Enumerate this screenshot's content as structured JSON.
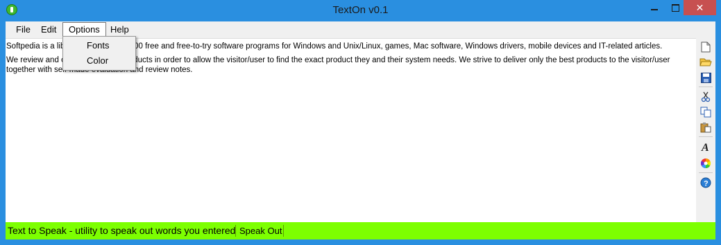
{
  "window": {
    "title": "TextOn v0.1",
    "controls": {
      "minimize": "minimize",
      "maximize": "maximize",
      "close": "✕"
    }
  },
  "menu": {
    "file": "File",
    "edit": "Edit",
    "options": "Options",
    "help": "Help"
  },
  "options_menu": {
    "items": [
      "Fonts",
      "Color"
    ]
  },
  "editor": {
    "paragraph1": "Softpedia is a library of over 1,300,000 free and free-to-try software programs for Windows and Unix/Linux, games, Mac software, Windows drivers, mobile devices and IT-related articles.",
    "paragraph2": "We review and categorize these products in order to allow the visitor/user to find the exact product they and their system needs. We strive to deliver only the best products to the visitor/user together with self-made evaluation and review notes."
  },
  "toolbar": {
    "icons": [
      "new-file-icon",
      "open-folder-icon",
      "save-icon",
      "cut-icon",
      "copy-icon",
      "paste-icon",
      "font-icon",
      "color-wheel-icon",
      "help-icon"
    ]
  },
  "status": {
    "text": "Text to Speak - utility to speak out words you entered",
    "speak_button": "Speak Out",
    "background": "#7dff00"
  },
  "colors": {
    "titlebar": "#2a8fe0",
    "close_button": "#c75050"
  }
}
